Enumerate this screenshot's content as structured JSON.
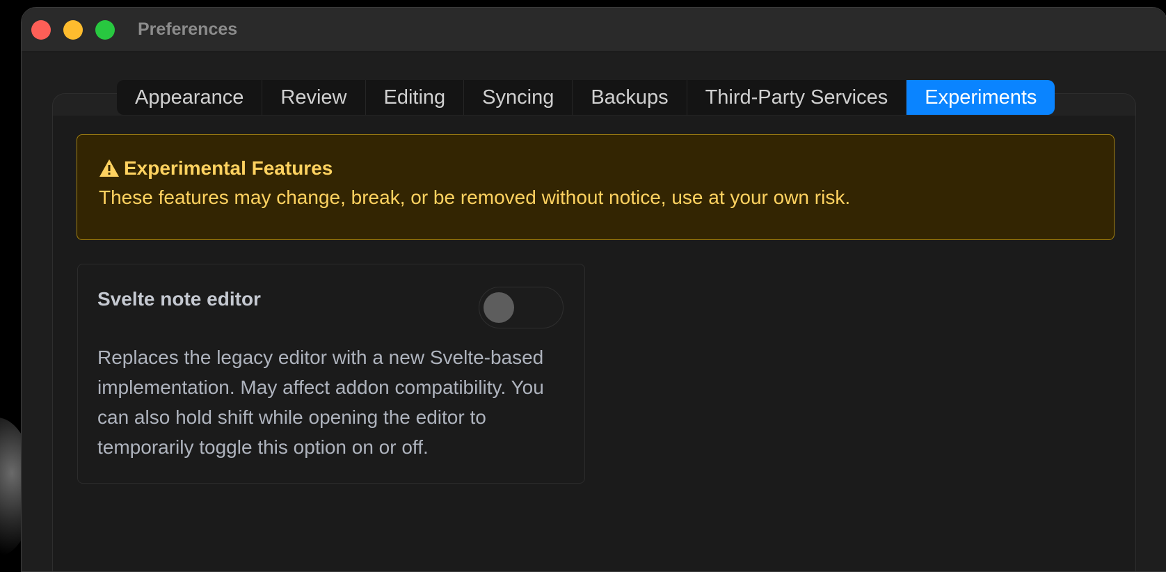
{
  "window": {
    "title": "Preferences"
  },
  "tabs": [
    {
      "label": "Appearance",
      "active": false
    },
    {
      "label": "Review",
      "active": false
    },
    {
      "label": "Editing",
      "active": false
    },
    {
      "label": "Syncing",
      "active": false
    },
    {
      "label": "Backups",
      "active": false
    },
    {
      "label": "Third-Party Services",
      "active": false
    },
    {
      "label": "Experiments",
      "active": true
    }
  ],
  "banner": {
    "icon": "warning-icon",
    "title": "Experimental Features",
    "text": "These features may change, break, or be removed without notice, use at your own risk."
  },
  "settings": {
    "svelte_editor": {
      "title": "Svelte note editor",
      "enabled": false,
      "description": "Replaces the legacy editor with a new Svelte-based implementation. May affect addon compatibility. You can also hold shift while opening the editor to temporarily toggle this option on or off."
    }
  },
  "colors": {
    "accent": "#0a84ff",
    "warning_text": "#fed260",
    "warning_bg": "#332502",
    "warning_border": "#a3810f"
  }
}
